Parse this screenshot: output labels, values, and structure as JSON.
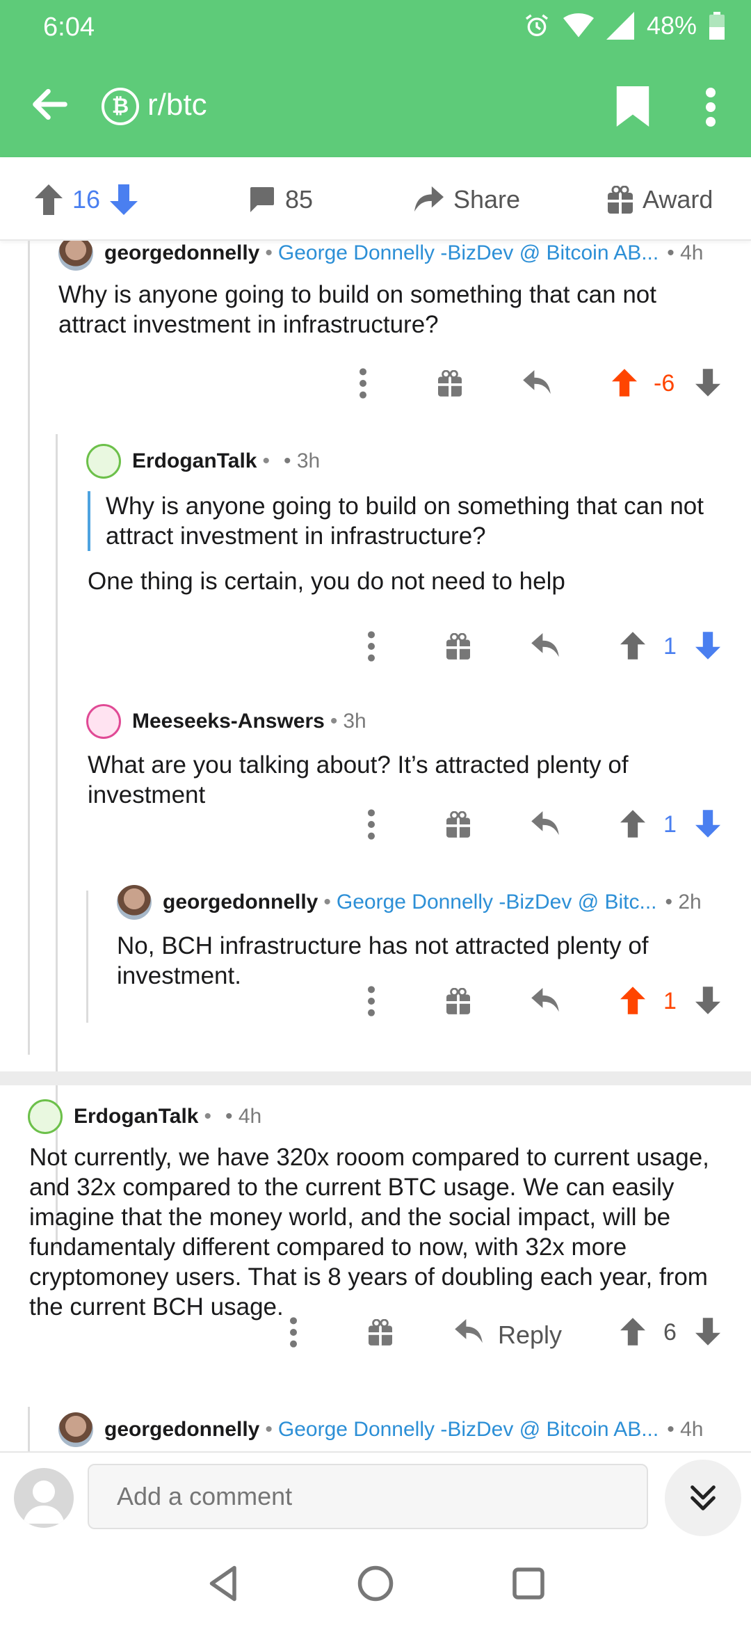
{
  "status": {
    "time": "6:04",
    "battery": "48%"
  },
  "appbar": {
    "subreddit": "r/btc",
    "icon_symbol": "₿"
  },
  "post_actions": {
    "score": "16",
    "comments": "85",
    "share_label": "Share",
    "award_label": "Award"
  },
  "comments": [
    {
      "author": "georgedonnelly",
      "flair": "George Donnelly -BizDev @ Bitcoin AB...",
      "age": "4h",
      "body": "Why is anyone going to build on something that can not attract investment in infrastructure?",
      "score": "-6"
    },
    {
      "author": "ErdoganTalk",
      "age": "3h",
      "quote": "Why is anyone going to build on something that can not attract investment in infrastructure?",
      "body": "One thing is certain, you do not need to help",
      "score": "1"
    },
    {
      "author": "Meeseeks-Answers",
      "age": "3h",
      "body": "What are you talking about? It’s attracted plenty of investment",
      "score": "1"
    },
    {
      "author": "georgedonnelly",
      "flair": "George Donnelly -BizDev @ Bitc...",
      "age": "2h",
      "body": "No, BCH infrastructure has not attracted plenty of investment.",
      "score": "1"
    },
    {
      "author": "ErdoganTalk",
      "age": "4h",
      "body": "Not currently, we have 320x rooom compared to current usage, and 32x compared to the current BTC usage. We can easily imagine that the money world, and the social impact, will be fundamentaly different compared to now, with 32x more cryptomoney users. That is 8 years of doubling each year, from the current BCH usage.",
      "reply_label": "Reply",
      "score": "6"
    },
    {
      "author": "georgedonnelly",
      "flair": "George Donnelly -BizDev @ Bitcoin AB...",
      "age": "4h"
    }
  ],
  "bottom": {
    "placeholder": "Add a comment"
  },
  "colors": {
    "brand_green": "#5ecb79",
    "upvote_orange": "#ff4500",
    "vote_blue": "#4a7ff0",
    "flair_blue": "#2c8fd6"
  }
}
